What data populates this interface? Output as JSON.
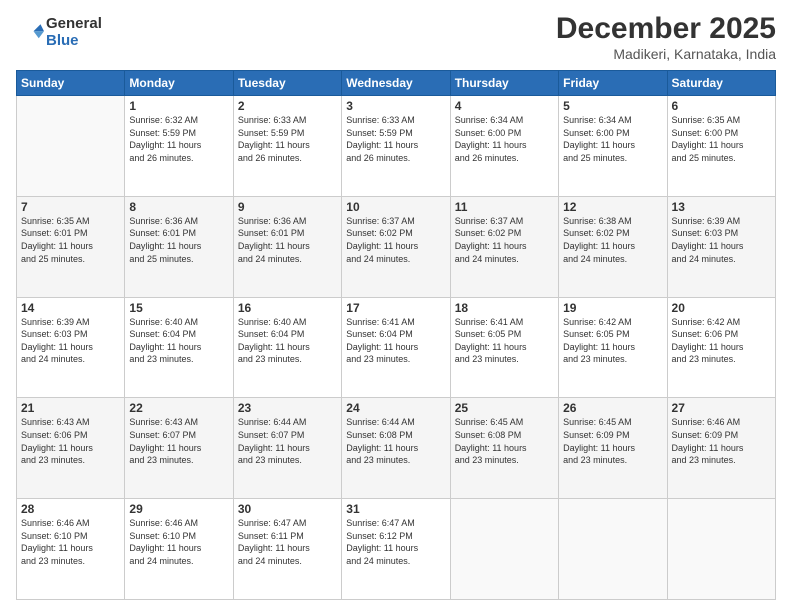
{
  "logo": {
    "general": "General",
    "blue": "Blue"
  },
  "title": "December 2025",
  "location": "Madikeri, Karnataka, India",
  "days_of_week": [
    "Sunday",
    "Monday",
    "Tuesday",
    "Wednesday",
    "Thursday",
    "Friday",
    "Saturday"
  ],
  "weeks": [
    [
      {
        "day": "",
        "info": ""
      },
      {
        "day": "1",
        "info": "Sunrise: 6:32 AM\nSunset: 5:59 PM\nDaylight: 11 hours\nand 26 minutes."
      },
      {
        "day": "2",
        "info": "Sunrise: 6:33 AM\nSunset: 5:59 PM\nDaylight: 11 hours\nand 26 minutes."
      },
      {
        "day": "3",
        "info": "Sunrise: 6:33 AM\nSunset: 5:59 PM\nDaylight: 11 hours\nand 26 minutes."
      },
      {
        "day": "4",
        "info": "Sunrise: 6:34 AM\nSunset: 6:00 PM\nDaylight: 11 hours\nand 26 minutes."
      },
      {
        "day": "5",
        "info": "Sunrise: 6:34 AM\nSunset: 6:00 PM\nDaylight: 11 hours\nand 25 minutes."
      },
      {
        "day": "6",
        "info": "Sunrise: 6:35 AM\nSunset: 6:00 PM\nDaylight: 11 hours\nand 25 minutes."
      }
    ],
    [
      {
        "day": "7",
        "info": "Sunrise: 6:35 AM\nSunset: 6:01 PM\nDaylight: 11 hours\nand 25 minutes."
      },
      {
        "day": "8",
        "info": "Sunrise: 6:36 AM\nSunset: 6:01 PM\nDaylight: 11 hours\nand 25 minutes."
      },
      {
        "day": "9",
        "info": "Sunrise: 6:36 AM\nSunset: 6:01 PM\nDaylight: 11 hours\nand 24 minutes."
      },
      {
        "day": "10",
        "info": "Sunrise: 6:37 AM\nSunset: 6:02 PM\nDaylight: 11 hours\nand 24 minutes."
      },
      {
        "day": "11",
        "info": "Sunrise: 6:37 AM\nSunset: 6:02 PM\nDaylight: 11 hours\nand 24 minutes."
      },
      {
        "day": "12",
        "info": "Sunrise: 6:38 AM\nSunset: 6:02 PM\nDaylight: 11 hours\nand 24 minutes."
      },
      {
        "day": "13",
        "info": "Sunrise: 6:39 AM\nSunset: 6:03 PM\nDaylight: 11 hours\nand 24 minutes."
      }
    ],
    [
      {
        "day": "14",
        "info": "Sunrise: 6:39 AM\nSunset: 6:03 PM\nDaylight: 11 hours\nand 24 minutes."
      },
      {
        "day": "15",
        "info": "Sunrise: 6:40 AM\nSunset: 6:04 PM\nDaylight: 11 hours\nand 23 minutes."
      },
      {
        "day": "16",
        "info": "Sunrise: 6:40 AM\nSunset: 6:04 PM\nDaylight: 11 hours\nand 23 minutes."
      },
      {
        "day": "17",
        "info": "Sunrise: 6:41 AM\nSunset: 6:04 PM\nDaylight: 11 hours\nand 23 minutes."
      },
      {
        "day": "18",
        "info": "Sunrise: 6:41 AM\nSunset: 6:05 PM\nDaylight: 11 hours\nand 23 minutes."
      },
      {
        "day": "19",
        "info": "Sunrise: 6:42 AM\nSunset: 6:05 PM\nDaylight: 11 hours\nand 23 minutes."
      },
      {
        "day": "20",
        "info": "Sunrise: 6:42 AM\nSunset: 6:06 PM\nDaylight: 11 hours\nand 23 minutes."
      }
    ],
    [
      {
        "day": "21",
        "info": "Sunrise: 6:43 AM\nSunset: 6:06 PM\nDaylight: 11 hours\nand 23 minutes."
      },
      {
        "day": "22",
        "info": "Sunrise: 6:43 AM\nSunset: 6:07 PM\nDaylight: 11 hours\nand 23 minutes."
      },
      {
        "day": "23",
        "info": "Sunrise: 6:44 AM\nSunset: 6:07 PM\nDaylight: 11 hours\nand 23 minutes."
      },
      {
        "day": "24",
        "info": "Sunrise: 6:44 AM\nSunset: 6:08 PM\nDaylight: 11 hours\nand 23 minutes."
      },
      {
        "day": "25",
        "info": "Sunrise: 6:45 AM\nSunset: 6:08 PM\nDaylight: 11 hours\nand 23 minutes."
      },
      {
        "day": "26",
        "info": "Sunrise: 6:45 AM\nSunset: 6:09 PM\nDaylight: 11 hours\nand 23 minutes."
      },
      {
        "day": "27",
        "info": "Sunrise: 6:46 AM\nSunset: 6:09 PM\nDaylight: 11 hours\nand 23 minutes."
      }
    ],
    [
      {
        "day": "28",
        "info": "Sunrise: 6:46 AM\nSunset: 6:10 PM\nDaylight: 11 hours\nand 23 minutes."
      },
      {
        "day": "29",
        "info": "Sunrise: 6:46 AM\nSunset: 6:10 PM\nDaylight: 11 hours\nand 24 minutes."
      },
      {
        "day": "30",
        "info": "Sunrise: 6:47 AM\nSunset: 6:11 PM\nDaylight: 11 hours\nand 24 minutes."
      },
      {
        "day": "31",
        "info": "Sunrise: 6:47 AM\nSunset: 6:12 PM\nDaylight: 11 hours\nand 24 minutes."
      },
      {
        "day": "",
        "info": ""
      },
      {
        "day": "",
        "info": ""
      },
      {
        "day": "",
        "info": ""
      }
    ]
  ]
}
